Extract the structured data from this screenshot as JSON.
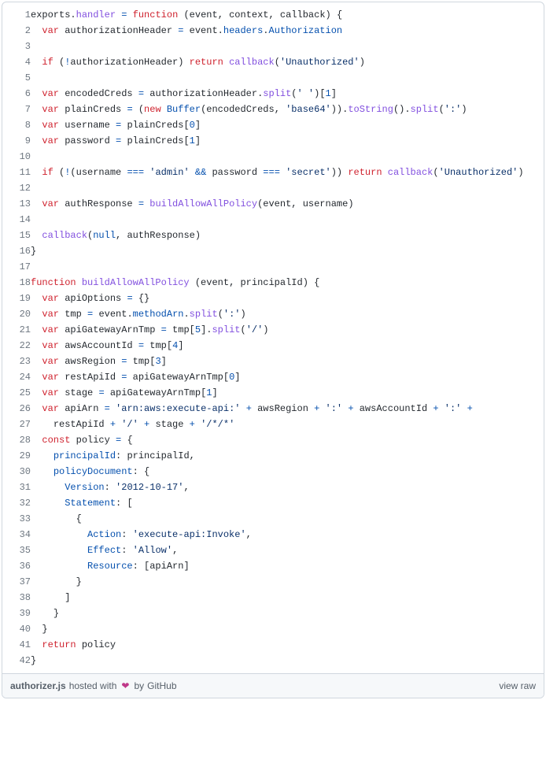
{
  "filename": "authorizer.js",
  "hosted_with_prefix": " hosted with ",
  "hosted_with_suffix": " by ",
  "host": "GitHub",
  "view_raw": "view raw",
  "heart": "❤",
  "lines": [
    {
      "n": 1,
      "h": "<span class=\"pl-smi\">exports</span><span class=\"pl-kos\">.</span><span class=\"pl-en\">handler</span> <span class=\"pl-c1\">=</span> <span class=\"pl-k\">function</span> <span class=\"pl-kos\">(</span><span class=\"pl-smi\">event</span><span class=\"pl-kos\">,</span> <span class=\"pl-smi\">context</span><span class=\"pl-kos\">,</span> <span class=\"pl-smi\">callback</span><span class=\"pl-kos\">)</span> <span class=\"pl-kos\">{</span>"
    },
    {
      "n": 2,
      "h": "  <span class=\"pl-k\">var</span> <span class=\"pl-smi\">authorizationHeader</span> <span class=\"pl-c1\">=</span> <span class=\"pl-smi\">event</span><span class=\"pl-kos\">.</span><span class=\"pl-c1\">headers</span><span class=\"pl-kos\">.</span><span class=\"pl-c1\">Authorization</span>"
    },
    {
      "n": 3,
      "h": ""
    },
    {
      "n": 4,
      "h": "  <span class=\"pl-k\">if</span> <span class=\"pl-kos\">(</span><span class=\"pl-c1\">!</span><span class=\"pl-smi\">authorizationHeader</span><span class=\"pl-kos\">)</span> <span class=\"pl-k\">return</span> <span class=\"pl-en\">callback</span><span class=\"pl-kos\">(</span><span class=\"pl-s\">'Unauthorized'</span><span class=\"pl-kos\">)</span>"
    },
    {
      "n": 5,
      "h": ""
    },
    {
      "n": 6,
      "h": "  <span class=\"pl-k\">var</span> <span class=\"pl-smi\">encodedCreds</span> <span class=\"pl-c1\">=</span> <span class=\"pl-smi\">authorizationHeader</span><span class=\"pl-kos\">.</span><span class=\"pl-en\">split</span><span class=\"pl-kos\">(</span><span class=\"pl-s\">' '</span><span class=\"pl-kos\">)</span><span class=\"pl-kos\">[</span><span class=\"pl-c1\">1</span><span class=\"pl-kos\">]</span>"
    },
    {
      "n": 7,
      "h": "  <span class=\"pl-k\">var</span> <span class=\"pl-smi\">plainCreds</span> <span class=\"pl-c1\">=</span> <span class=\"pl-kos\">(</span><span class=\"pl-k\">new</span> <span class=\"pl-c1\">Buffer</span><span class=\"pl-kos\">(</span><span class=\"pl-smi\">encodedCreds</span><span class=\"pl-kos\">,</span> <span class=\"pl-s\">'base64'</span><span class=\"pl-kos\">)</span><span class=\"pl-kos\">)</span><span class=\"pl-kos\">.</span><span class=\"pl-en\">toString</span><span class=\"pl-kos\">(</span><span class=\"pl-kos\">)</span><span class=\"pl-kos\">.</span><span class=\"pl-en\">split</span><span class=\"pl-kos\">(</span><span class=\"pl-s\">':'</span><span class=\"pl-kos\">)</span>"
    },
    {
      "n": 8,
      "h": "  <span class=\"pl-k\">var</span> <span class=\"pl-smi\">username</span> <span class=\"pl-c1\">=</span> <span class=\"pl-smi\">plainCreds</span><span class=\"pl-kos\">[</span><span class=\"pl-c1\">0</span><span class=\"pl-kos\">]</span>"
    },
    {
      "n": 9,
      "h": "  <span class=\"pl-k\">var</span> <span class=\"pl-smi\">password</span> <span class=\"pl-c1\">=</span> <span class=\"pl-smi\">plainCreds</span><span class=\"pl-kos\">[</span><span class=\"pl-c1\">1</span><span class=\"pl-kos\">]</span>"
    },
    {
      "n": 10,
      "h": ""
    },
    {
      "n": 11,
      "h": "  <span class=\"pl-k\">if</span> <span class=\"pl-kos\">(</span><span class=\"pl-c1\">!</span><span class=\"pl-kos\">(</span><span class=\"pl-smi\">username</span> <span class=\"pl-c1\">===</span> <span class=\"pl-s\">'admin'</span> <span class=\"pl-c1\">&amp;&amp;</span> <span class=\"pl-smi\">password</span> <span class=\"pl-c1\">===</span> <span class=\"pl-s\">'secret'</span><span class=\"pl-kos\">)</span><span class=\"pl-kos\">)</span> <span class=\"pl-k\">return</span> <span class=\"pl-en\">callback</span><span class=\"pl-kos\">(</span><span class=\"pl-s\">'Unauthorized'</span><span class=\"pl-kos\">)</span>"
    },
    {
      "n": 12,
      "h": ""
    },
    {
      "n": 13,
      "h": "  <span class=\"pl-k\">var</span> <span class=\"pl-smi\">authResponse</span> <span class=\"pl-c1\">=</span> <span class=\"pl-en\">buildAllowAllPolicy</span><span class=\"pl-kos\">(</span><span class=\"pl-smi\">event</span><span class=\"pl-kos\">,</span> <span class=\"pl-smi\">username</span><span class=\"pl-kos\">)</span>"
    },
    {
      "n": 14,
      "h": ""
    },
    {
      "n": 15,
      "h": "  <span class=\"pl-en\">callback</span><span class=\"pl-kos\">(</span><span class=\"pl-c1\">null</span><span class=\"pl-kos\">,</span> <span class=\"pl-smi\">authResponse</span><span class=\"pl-kos\">)</span>"
    },
    {
      "n": 16,
      "h": "<span class=\"pl-kos\">}</span>"
    },
    {
      "n": 17,
      "h": ""
    },
    {
      "n": 18,
      "h": "<span class=\"pl-k\">function</span> <span class=\"pl-en\">buildAllowAllPolicy</span> <span class=\"pl-kos\">(</span><span class=\"pl-smi\">event</span><span class=\"pl-kos\">,</span> <span class=\"pl-smi\">principalId</span><span class=\"pl-kos\">)</span> <span class=\"pl-kos\">{</span>"
    },
    {
      "n": 19,
      "h": "  <span class=\"pl-k\">var</span> <span class=\"pl-smi\">apiOptions</span> <span class=\"pl-c1\">=</span> <span class=\"pl-kos\">{</span><span class=\"pl-kos\">}</span>"
    },
    {
      "n": 20,
      "h": "  <span class=\"pl-k\">var</span> <span class=\"pl-smi\">tmp</span> <span class=\"pl-c1\">=</span> <span class=\"pl-smi\">event</span><span class=\"pl-kos\">.</span><span class=\"pl-c1\">methodArn</span><span class=\"pl-kos\">.</span><span class=\"pl-en\">split</span><span class=\"pl-kos\">(</span><span class=\"pl-s\">':'</span><span class=\"pl-kos\">)</span>"
    },
    {
      "n": 21,
      "h": "  <span class=\"pl-k\">var</span> <span class=\"pl-smi\">apiGatewayArnTmp</span> <span class=\"pl-c1\">=</span> <span class=\"pl-smi\">tmp</span><span class=\"pl-kos\">[</span><span class=\"pl-c1\">5</span><span class=\"pl-kos\">]</span><span class=\"pl-kos\">.</span><span class=\"pl-en\">split</span><span class=\"pl-kos\">(</span><span class=\"pl-s\">'/'</span><span class=\"pl-kos\">)</span>"
    },
    {
      "n": 22,
      "h": "  <span class=\"pl-k\">var</span> <span class=\"pl-smi\">awsAccountId</span> <span class=\"pl-c1\">=</span> <span class=\"pl-smi\">tmp</span><span class=\"pl-kos\">[</span><span class=\"pl-c1\">4</span><span class=\"pl-kos\">]</span>"
    },
    {
      "n": 23,
      "h": "  <span class=\"pl-k\">var</span> <span class=\"pl-smi\">awsRegion</span> <span class=\"pl-c1\">=</span> <span class=\"pl-smi\">tmp</span><span class=\"pl-kos\">[</span><span class=\"pl-c1\">3</span><span class=\"pl-kos\">]</span>"
    },
    {
      "n": 24,
      "h": "  <span class=\"pl-k\">var</span> <span class=\"pl-smi\">restApiId</span> <span class=\"pl-c1\">=</span> <span class=\"pl-smi\">apiGatewayArnTmp</span><span class=\"pl-kos\">[</span><span class=\"pl-c1\">0</span><span class=\"pl-kos\">]</span>"
    },
    {
      "n": 25,
      "h": "  <span class=\"pl-k\">var</span> <span class=\"pl-smi\">stage</span> <span class=\"pl-c1\">=</span> <span class=\"pl-smi\">apiGatewayArnTmp</span><span class=\"pl-kos\">[</span><span class=\"pl-c1\">1</span><span class=\"pl-kos\">]</span>"
    },
    {
      "n": 26,
      "h": "  <span class=\"pl-k\">var</span> <span class=\"pl-smi\">apiArn</span> <span class=\"pl-c1\">=</span> <span class=\"pl-s\">'arn:aws:execute-api:'</span> <span class=\"pl-c1\">+</span> <span class=\"pl-smi\">awsRegion</span> <span class=\"pl-c1\">+</span> <span class=\"pl-s\">':'</span> <span class=\"pl-c1\">+</span> <span class=\"pl-smi\">awsAccountId</span> <span class=\"pl-c1\">+</span> <span class=\"pl-s\">':'</span> <span class=\"pl-c1\">+</span>"
    },
    {
      "n": 27,
      "h": "    <span class=\"pl-smi\">restApiId</span> <span class=\"pl-c1\">+</span> <span class=\"pl-s\">'/'</span> <span class=\"pl-c1\">+</span> <span class=\"pl-smi\">stage</span> <span class=\"pl-c1\">+</span> <span class=\"pl-s\">'/*/*'</span>"
    },
    {
      "n": 28,
      "h": "  <span class=\"pl-k\">const</span> <span class=\"pl-smi\">policy</span> <span class=\"pl-c1\">=</span> <span class=\"pl-kos\">{</span>"
    },
    {
      "n": 29,
      "h": "    <span class=\"pl-c1\">principalId</span>: <span class=\"pl-smi\">principalId</span><span class=\"pl-kos\">,</span>"
    },
    {
      "n": 30,
      "h": "    <span class=\"pl-c1\">policyDocument</span>: <span class=\"pl-kos\">{</span>"
    },
    {
      "n": 31,
      "h": "      <span class=\"pl-c1\">Version</span>: <span class=\"pl-s\">'2012-10-17'</span><span class=\"pl-kos\">,</span>"
    },
    {
      "n": 32,
      "h": "      <span class=\"pl-c1\">Statement</span>: <span class=\"pl-kos\">[</span>"
    },
    {
      "n": 33,
      "h": "        <span class=\"pl-kos\">{</span>"
    },
    {
      "n": 34,
      "h": "          <span class=\"pl-c1\">Action</span>: <span class=\"pl-s\">'execute-api:Invoke'</span><span class=\"pl-kos\">,</span>"
    },
    {
      "n": 35,
      "h": "          <span class=\"pl-c1\">Effect</span>: <span class=\"pl-s\">'Allow'</span><span class=\"pl-kos\">,</span>"
    },
    {
      "n": 36,
      "h": "          <span class=\"pl-c1\">Resource</span>: <span class=\"pl-kos\">[</span><span class=\"pl-smi\">apiArn</span><span class=\"pl-kos\">]</span>"
    },
    {
      "n": 37,
      "h": "        <span class=\"pl-kos\">}</span>"
    },
    {
      "n": 38,
      "h": "      <span class=\"pl-kos\">]</span>"
    },
    {
      "n": 39,
      "h": "    <span class=\"pl-kos\">}</span>"
    },
    {
      "n": 40,
      "h": "  <span class=\"pl-kos\">}</span>"
    },
    {
      "n": 41,
      "h": "  <span class=\"pl-k\">return</span> <span class=\"pl-smi\">policy</span>"
    },
    {
      "n": 42,
      "h": "<span class=\"pl-kos\">}</span>"
    }
  ]
}
